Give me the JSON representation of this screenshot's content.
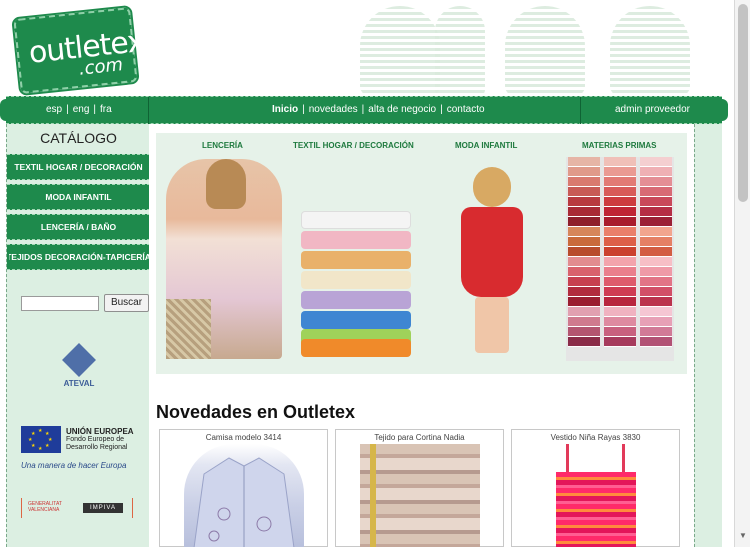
{
  "logo": {
    "line1": "outletex",
    "line2": ".com"
  },
  "nav": {
    "languages": [
      "esp",
      "eng",
      "fra"
    ],
    "main": [
      "Inicio",
      "novedades",
      "alta de negocio",
      "contacto"
    ],
    "admin": "admin proveedor"
  },
  "sidebar": {
    "title": "CATÁLOGO",
    "items": [
      "TEXTIL HOGAR / DECORACIÓN",
      "MODA INFANTIL",
      "LENCERÍA / BAÑO",
      "TEJIDOS DECORACIÓN-TAPICERÍA"
    ],
    "search_button": "Buscar",
    "search_value": "",
    "ateval": "ATEVAL",
    "eu": {
      "title": "UNIÓN EUROPEA",
      "sub": "Fondo Europeo de Desarrollo Regional",
      "slogan": "Una manera de hacer Europa"
    },
    "gv_text": "GENERALITAT VALENCIANA",
    "impiva": "IMPIVA"
  },
  "banner": {
    "labels": [
      "LENCERÍA",
      "TEXTIL HOGAR / DECORACIÓN",
      "MODA INFANTIL",
      "MATERIAS PRIMAS"
    ]
  },
  "novedades": {
    "title": "Novedades en Outletex",
    "products": [
      "Camisa modelo 3414",
      "Tejido para Cortina Nadia",
      "Vestido Niña Rayas 3830"
    ]
  },
  "colors": {
    "brand_green": "#1e8a4c",
    "sidebar_bg": "#dcefe2",
    "banner_bg": "#e6f2e9"
  }
}
